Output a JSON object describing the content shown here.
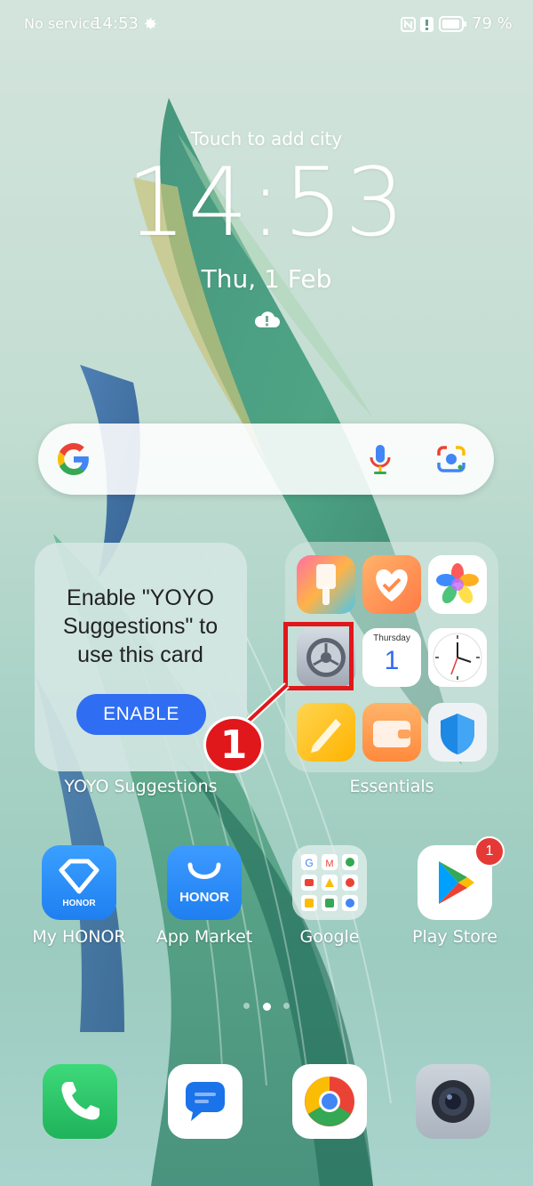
{
  "status_bar": {
    "carrier": "No service",
    "time": "14:53",
    "battery": "79 %"
  },
  "clock_widget": {
    "city_prompt": "Touch to add city",
    "time": "14:53",
    "date": "Thu, 1 Feb"
  },
  "yoyo_card": {
    "message": "Enable \"YOYO Suggestions\" to use this card",
    "button_label": "ENABLE",
    "widget_label": "YOYO Suggestions"
  },
  "essentials_folder": {
    "label": "Essentials",
    "calendar_day": "Thursday",
    "calendar_date": "1"
  },
  "apps": [
    {
      "label": "My HONOR",
      "icon_text": "HONOR"
    },
    {
      "label": "App Market",
      "icon_text": "HONOR"
    },
    {
      "label": "Google"
    },
    {
      "label": "Play Store",
      "badge": "1"
    }
  ],
  "annotation": {
    "step": "1",
    "color": "#e0171b"
  },
  "colors": {
    "enable_button": "#2f6df3",
    "badge": "#e53935"
  }
}
